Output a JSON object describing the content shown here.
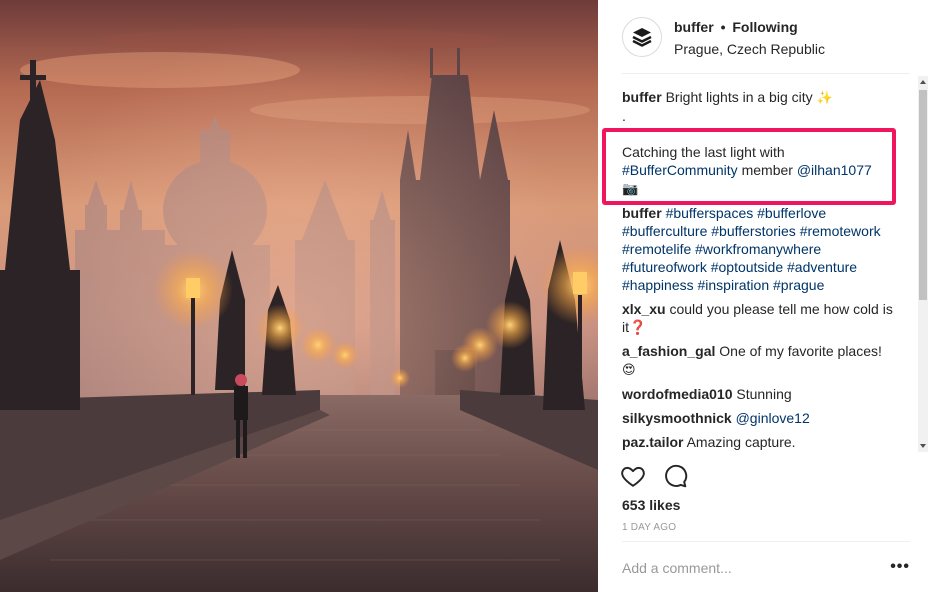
{
  "header": {
    "username": "buffer",
    "separator": "•",
    "follow_status": "Following",
    "location": "Prague, Czech Republic"
  },
  "caption": {
    "username": "buffer",
    "line1": "Bright lights in a big city",
    "line1_emoji": "✨",
    "line2": ".",
    "highlighted_text": "Catching the last light with",
    "highlighted_tag": "#BufferCommunity",
    "highlighted_mid": "member",
    "highlighted_mention": "@ilhan1077",
    "highlighted_emoji": "📷"
  },
  "hashtag_comment": {
    "username": "buffer",
    "tags": "#bufferspaces #bufferlove #bufferculture #bufferstories #remotework #remotelife #workfromanywhere #futureofwork #optoutside #adventure #happiness #inspiration #prague"
  },
  "comments": [
    {
      "username": "xlx_xu",
      "text": "could you please tell me how cold is it❓"
    },
    {
      "username": "a_fashion_gal",
      "text": "One of my favorite places!",
      "emoji": "😍"
    },
    {
      "username": "wordofmedia010",
      "text": "Stunning"
    },
    {
      "username": "silkysmoothnick",
      "mention": "@ginlove12"
    },
    {
      "username": "paz.tailor",
      "text": "Amazing capture."
    }
  ],
  "likes": "653 likes",
  "timestamp": "1 DAY AGO",
  "add_comment": {
    "placeholder": "Add a comment..."
  },
  "more_label": "•••",
  "icons": {
    "avatar": "buffer-logo-icon",
    "like": "heart-icon",
    "comment": "comment-bubble-icon",
    "more": "more-options-icon"
  },
  "colors": {
    "text": "#262626",
    "link": "#003569",
    "muted": "#999999",
    "highlight_border": "#f0165d"
  }
}
